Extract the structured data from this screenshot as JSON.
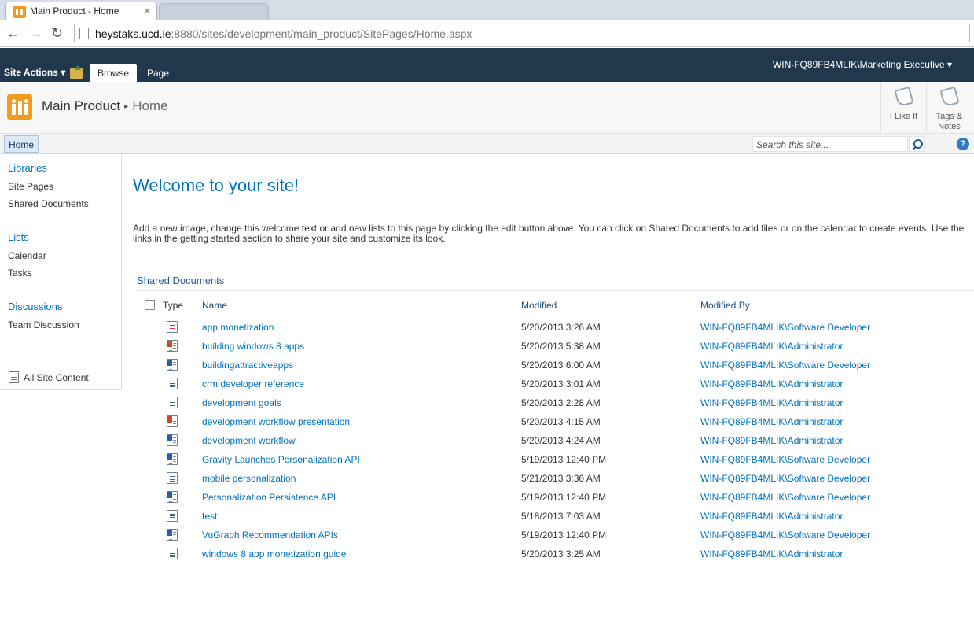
{
  "browser": {
    "tab_title": "Main Product - Home",
    "tab_close": "×",
    "url_host": "heystaks.ucd.ie",
    "url_rest": ":8880/sites/development/main_product/SitePages/Home.aspx"
  },
  "ribbon": {
    "site_actions": "Site Actions ▾",
    "tabs": [
      "Browse",
      "Page"
    ],
    "user": "WIN-FQ89FB4MLIK\\Marketing Executive ▾"
  },
  "titlearea": {
    "site": "Main Product",
    "separator": "▸",
    "page": "Home",
    "like_label": "I Like It",
    "tags_label": "Tags & Notes"
  },
  "topnav": {
    "home": "Home",
    "search_placeholder": "Search this site...",
    "help": "?"
  },
  "quicklaunch": {
    "libraries": "Libraries",
    "library_items": [
      "Site Pages",
      "Shared Documents"
    ],
    "lists": "Lists",
    "list_items": [
      "Calendar",
      "Tasks"
    ],
    "discussions": "Discussions",
    "discussion_items": [
      "Team Discussion"
    ],
    "all_site_content": "All Site Content"
  },
  "main": {
    "welcome": "Welcome to your site!",
    "intro": "Add a new image, change this welcome text or add new lists to this page by clicking the edit button above. You can click on Shared Documents to add files or on the calendar to create events. Use the links in the getting started section to share your site and customize its look.",
    "webpart_title": "Shared Documents",
    "columns": [
      "Type",
      "Name",
      "Modified",
      "Modified By"
    ],
    "documents": [
      {
        "type": "txt",
        "name": "app monetization",
        "modified": "5/20/2013 3:26 AM",
        "modified_by": "WIN-FQ89FB4MLIK\\Software Developer"
      },
      {
        "type": "ppt",
        "name": "building windows 8 apps",
        "modified": "5/20/2013 5:38 AM",
        "modified_by": "WIN-FQ89FB4MLIK\\Administrator"
      },
      {
        "type": "word",
        "name": "buildingattractiveapps",
        "modified": "5/20/2013 6:00 AM",
        "modified_by": "WIN-FQ89FB4MLIK\\Software Developer"
      },
      {
        "type": "txt",
        "name": "crm developer reference",
        "modified": "5/20/2013 3:01 AM",
        "modified_by": "WIN-FQ89FB4MLIK\\Administrator"
      },
      {
        "type": "txt",
        "name": "development goals",
        "modified": "5/20/2013 2:28 AM",
        "modified_by": "WIN-FQ89FB4MLIK\\Administrator"
      },
      {
        "type": "ppt",
        "name": "development workflow presentation",
        "modified": "5/20/2013 4:15 AM",
        "modified_by": "WIN-FQ89FB4MLIK\\Administrator"
      },
      {
        "type": "word",
        "name": "development workflow",
        "modified": "5/20/2013 4:24 AM",
        "modified_by": "WIN-FQ89FB4MLIK\\Administrator"
      },
      {
        "type": "word",
        "name": "Gravity Launches Personalization API",
        "modified": "5/19/2013 12:40 PM",
        "modified_by": "WIN-FQ89FB4MLIK\\Software Developer"
      },
      {
        "type": "txt",
        "name": "mobile personalization",
        "modified": "5/21/2013 3:36 AM",
        "modified_by": "WIN-FQ89FB4MLIK\\Software Developer"
      },
      {
        "type": "word",
        "name": "Personalization Persistence API",
        "modified": "5/19/2013 12:40 PM",
        "modified_by": "WIN-FQ89FB4MLIK\\Software Developer"
      },
      {
        "type": "txt",
        "name": "test",
        "modified": "5/18/2013 7:03 AM",
        "modified_by": "WIN-FQ89FB4MLIK\\Administrator"
      },
      {
        "type": "word",
        "name": "VuGraph Recommendation APIs",
        "modified": "5/19/2013 12:40 PM",
        "modified_by": "WIN-FQ89FB4MLIK\\Software Developer"
      },
      {
        "type": "txt",
        "name": "windows 8 app monetization guide",
        "modified": "5/20/2013 3:25 AM",
        "modified_by": "WIN-FQ89FB4MLIK\\Administrator"
      }
    ]
  },
  "colors": {
    "ribbon": "#21374c",
    "link": "#0072bc",
    "logo": "#f39a1f"
  }
}
